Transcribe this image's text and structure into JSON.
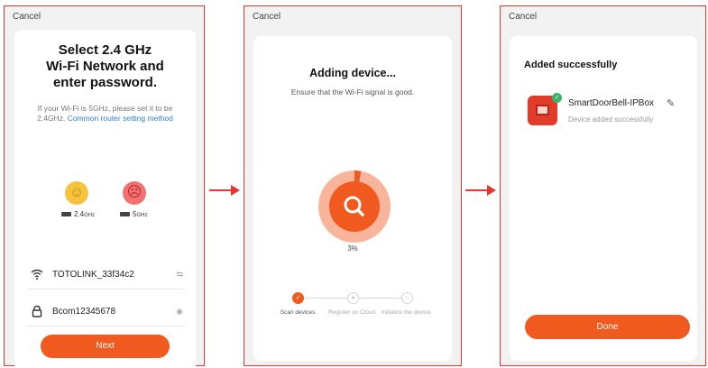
{
  "screen1": {
    "cancel": "Cancel",
    "title": "Select 2.4 GHz\nWi-Fi Network and\nenter password.",
    "hint_prefix": "If your Wi-Fi is 5GHz, please set it to be 2.4GHz.",
    "hint_link": "Common router setting method",
    "band_24": "2.4",
    "band_24_unit": "GHz",
    "band_5": "5",
    "band_5_unit": "GHz",
    "wifi_name": "TOTOLINK_33f34c2",
    "password": "Bcom12345678",
    "next": "Next"
  },
  "screen2": {
    "cancel": "Cancel",
    "title": "Adding device...",
    "subtitle": "Ensure that the Wi-Fi signal is good.",
    "progress_label": "3%",
    "progress": 0.03,
    "steps": [
      {
        "label": "Scan devices.",
        "active": true
      },
      {
        "label": "Register on Cloud.",
        "active": false
      },
      {
        "label": "Initialize the device.",
        "active": false
      }
    ]
  },
  "screen3": {
    "cancel": "Cancel",
    "title": "Added successfully",
    "device_name": "SmartDoorBell-IPBox",
    "device_status": "Device added successfully",
    "done": "Done"
  },
  "icons": [
    "smile-icon",
    "sad-icon",
    "router-icon",
    "wifi-icon",
    "lock-icon",
    "swap-icon",
    "eye-icon",
    "search-icon",
    "check-icon",
    "edit-icon",
    "arrow-right-icon"
  ],
  "colors": {
    "accent": "#f05a1f",
    "link": "#2f7fd6",
    "success": "#37b36b",
    "frame": "#e2382e"
  }
}
